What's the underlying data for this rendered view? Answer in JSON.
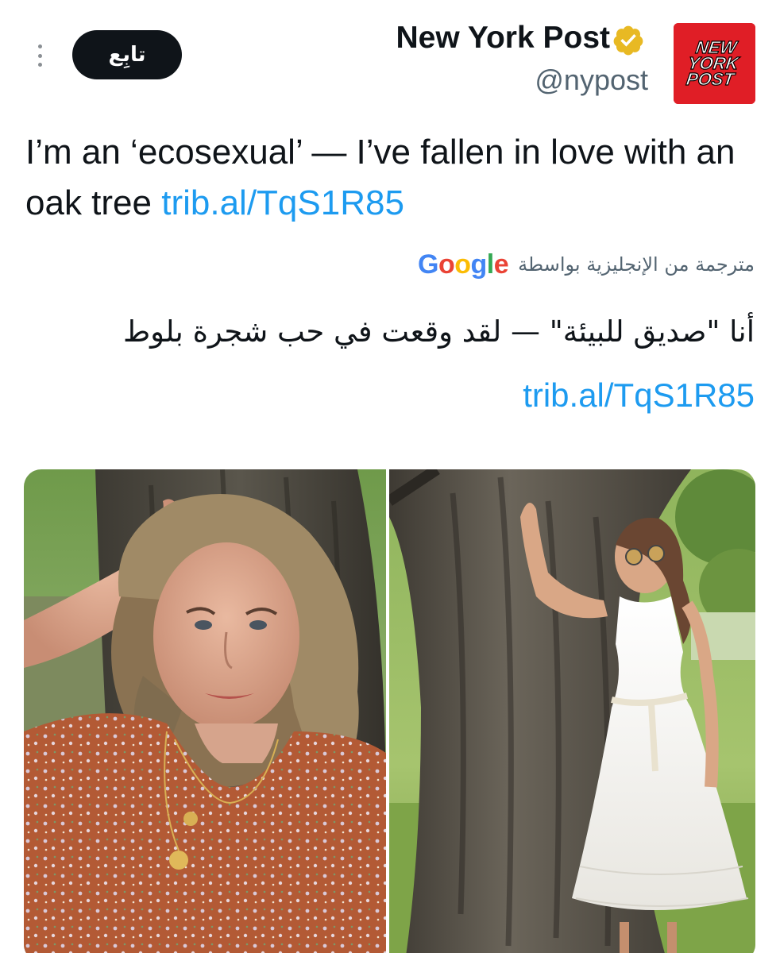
{
  "header": {
    "account_name": "New York Post",
    "handle": "@nypost",
    "follow_label": "تابِع",
    "avatar_text": [
      "NEW",
      "YORK",
      "POST"
    ],
    "verified_color": "#e8b923"
  },
  "tweet": {
    "text": "I’m an ‘ecosexual’ — I’ve fallen in love with an oak tree ",
    "link": "trib.al/TqS1R85"
  },
  "translation": {
    "label": "مترجمة من الإنجليزية بواسطة",
    "provider": [
      "G",
      "o",
      "o",
      "g",
      "l",
      "e"
    ],
    "provider_colors": [
      "#4285F4",
      "#EA4335",
      "#FBBC05",
      "#4285F4",
      "#34A853",
      "#EA4335"
    ],
    "text": "أنا \"صديق للبيئة\" — لقد وقعت في حب شجرة بلوط ",
    "link": "trib.al/TqS1R85"
  },
  "colors": {
    "link": "#1d9bf0",
    "secondary_text": "#536471",
    "button_bg": "#0f1419",
    "brand_red": "#e01e26"
  },
  "media": {
    "photos": [
      "woman-in-floral-top-by-tree",
      "woman-in-white-dress-by-oak-tree"
    ]
  }
}
